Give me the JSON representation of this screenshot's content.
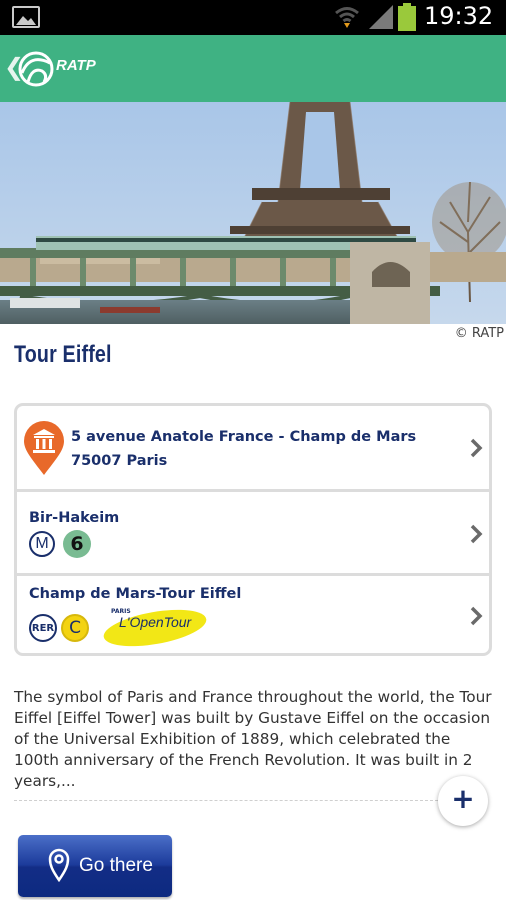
{
  "status_bar": {
    "time": "19:32",
    "icons": [
      "image-notification-icon",
      "wifi-icon",
      "signal-icon",
      "battery-icon"
    ],
    "battery_color": "#9ac93b"
  },
  "action_bar": {
    "brand": "RATP",
    "color": "#3fb283",
    "back_glyph": "❮"
  },
  "hero": {
    "credit": "© RATP"
  },
  "place": {
    "title": "Tour Eiffel"
  },
  "address": {
    "line1": "5 avenue Anatole France - Champ de Mars",
    "line2": "75007 Paris"
  },
  "stations": [
    {
      "name": "Bir-Hakeim",
      "lines": [
        {
          "type": "M",
          "label": "M"
        },
        {
          "type": "metro-line",
          "label": "6",
          "color": "#79bb92"
        }
      ]
    },
    {
      "name": "Champ de Mars-Tour Eiffel",
      "lines": [
        {
          "type": "RER",
          "label": "RER"
        },
        {
          "type": "rer-line",
          "label": "C",
          "color": "#f3d311"
        },
        {
          "type": "logo",
          "label": "L'OpenTour",
          "sub": "PARIS"
        }
      ]
    }
  ],
  "description": "The symbol of Paris and France throughout the world, the Tour Eiffel [Eiffel Tower] was built by Gustave Eiffel on the occasion of the Universal Exhibition of 1889, which celebrated the 100th anniversary of the French Revolution. It was built in 2 years,...",
  "expand_label": "+",
  "go_button": {
    "label": "Go there"
  },
  "colors": {
    "navy": "#1a2f6b",
    "pin": "#e8692a",
    "button": "#1c3b9b"
  }
}
